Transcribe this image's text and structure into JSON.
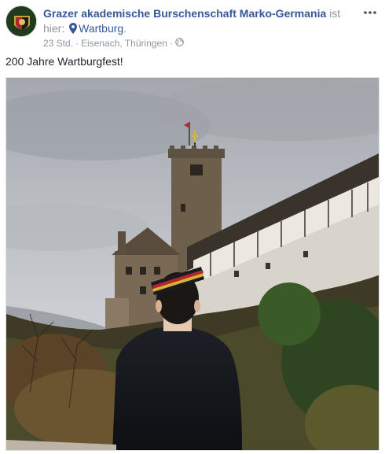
{
  "post": {
    "page_name": "Grazer akademische Burschenschaft Marko-Germania",
    "location_prefix": " ist hier: ",
    "location_name": "Wartburg",
    "location_suffix": ".",
    "timestamp": "23 Std.",
    "separator": "·",
    "place_detail": "Eisenach, Thüringen",
    "privacy_icon": "globe-icon",
    "more_icon": "more-dots-icon",
    "body_text": "200 Jahre Wartburgfest!"
  },
  "colors": {
    "link": "#365899",
    "meta_text": "#90949c",
    "body_text": "#1d2129"
  }
}
